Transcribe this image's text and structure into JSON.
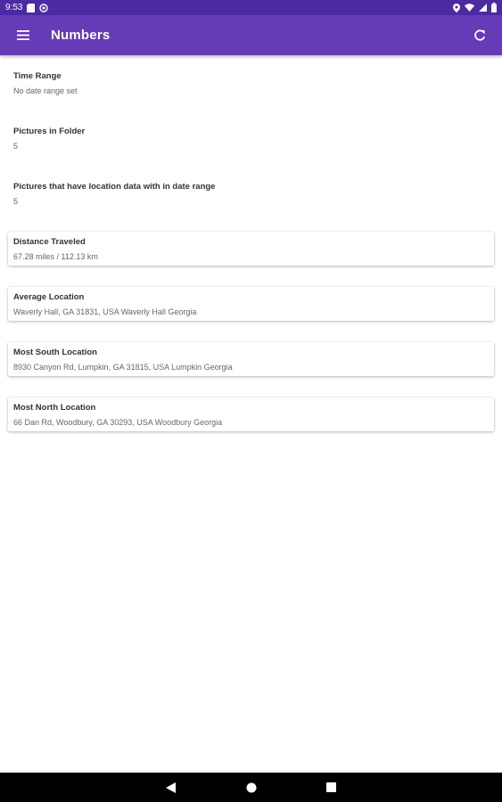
{
  "status_bar": {
    "time": "9:53",
    "icons_left": [
      "sd-card-icon",
      "at-sign-icon"
    ],
    "icons_right": [
      "location-icon",
      "wifi-icon",
      "signal-icon",
      "battery-icon"
    ]
  },
  "app_bar": {
    "title": "Numbers",
    "menu_icon": "hamburger-menu-icon",
    "refresh_icon": "refresh-icon",
    "background": "#673ab7",
    "status_background": "#4b2aa2"
  },
  "stats": {
    "time_range": {
      "label": "Time Range",
      "value": "No date range set"
    },
    "pictures_in_folder": {
      "label": "Pictures in Folder",
      "value": "5"
    },
    "pictures_with_location": {
      "label": "Pictures that have location data with in date range",
      "value": "5"
    }
  },
  "cards": {
    "distance": {
      "label": "Distance Traveled",
      "value": "67.28 miles / 112.13 km"
    },
    "average": {
      "label": "Average Location",
      "value": "Waverly Hall, GA 31831, USA Waverly Hall Georgia"
    },
    "south": {
      "label": "Most South Location",
      "value": "8930 Canyon Rd, Lumpkin, GA 31815, USA Lumpkin Georgia"
    },
    "north": {
      "label": "Most North Location",
      "value": "66 Dan Rd, Woodbury, GA 30293, USA Woodbury Georgia"
    }
  },
  "nav_bar": {
    "back_icon": "back-triangle-icon",
    "home_icon": "home-circle-icon",
    "recents_icon": "recents-square-icon"
  }
}
